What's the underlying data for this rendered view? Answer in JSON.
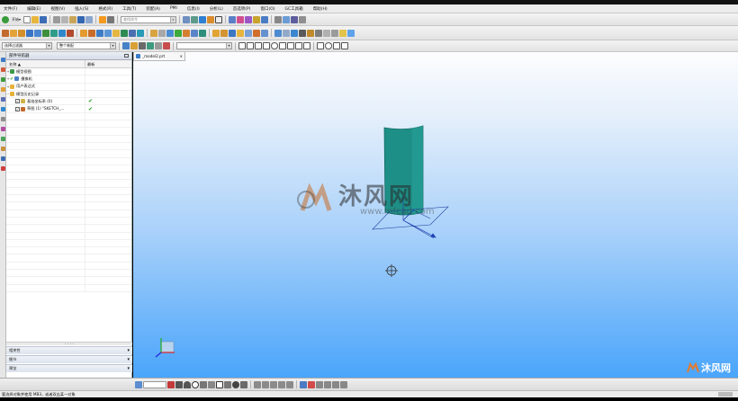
{
  "menu": [
    "文件(F)",
    "编辑(E)",
    "视图(V)",
    "插入(S)",
    "格式(R)",
    "工具(T)",
    "装配(A)",
    "PMI",
    "信息(I)",
    "分析(L)",
    "首选项(P)",
    "窗口(O)",
    "GC工具箱",
    "帮助(H)"
  ],
  "toolbar": {
    "start_label": "开始▾",
    "command_search_placeholder": "查找命令",
    "selection_filter": "选择过滤器",
    "assembly_scope": "整个装配"
  },
  "part_navigator": {
    "title": "部件导航器",
    "col_name": "名称",
    "col_latest": "最新",
    "rows": [
      {
        "name": "模型视图",
        "check": ""
      },
      {
        "name": "摄像机",
        "check": ""
      },
      {
        "name": "用户表达式",
        "check": ""
      },
      {
        "name": "模型历史记录",
        "check": ""
      },
      {
        "name": "基准坐标系 (0)",
        "check": "✔"
      },
      {
        "name": "草图 (1) \"SKETCH_...",
        "check": "✔"
      }
    ],
    "sections": [
      "相关性",
      "细节",
      "预览"
    ]
  },
  "viewport": {
    "tab_label": "_model2.prt",
    "watermark_cn": "沐风网",
    "watermark_url": "www.mfcad.com",
    "corner_watermark": "沐风网"
  },
  "statusbar": {
    "message": "要选择对象并使用 MB3，或者双击某一对象"
  },
  "colors": {
    "viewport_top": "#fdfdfe",
    "viewport_bottom": "#4aa5fb",
    "surface": "#1e8f87",
    "check_green": "#2aa02a"
  }
}
